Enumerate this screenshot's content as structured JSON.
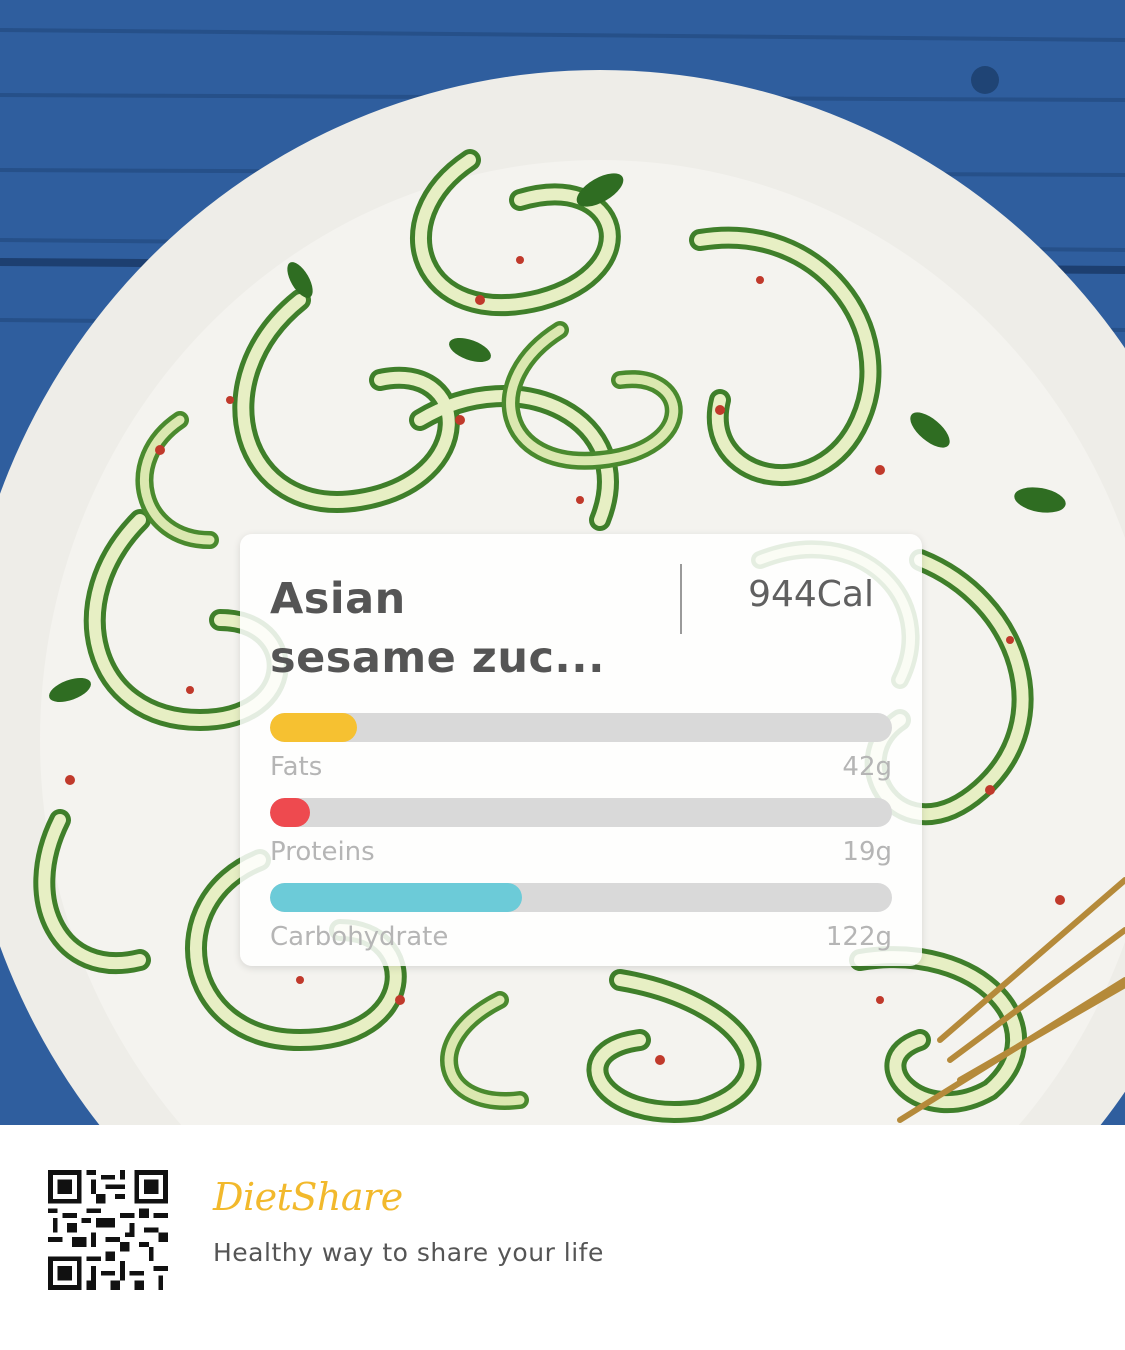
{
  "food": {
    "name": "Asian sesame zuc...",
    "calories": "944Cal"
  },
  "nutrients": [
    {
      "label": "Fats",
      "value": "42g",
      "fraction": 0.14,
      "color": "#f6c131"
    },
    {
      "label": "Proteins",
      "value": "19g",
      "fraction": 0.065,
      "color": "#ee4a4f"
    },
    {
      "label": "Carbohydrate",
      "value": "122g",
      "fraction": 0.405,
      "color": "#6ccbd8"
    }
  ],
  "footer": {
    "brand": "DietShare",
    "tagline": "Healthy way to share your life",
    "brand_color": "#f2b92c"
  },
  "icons": {
    "qr": "qr-code-icon"
  }
}
